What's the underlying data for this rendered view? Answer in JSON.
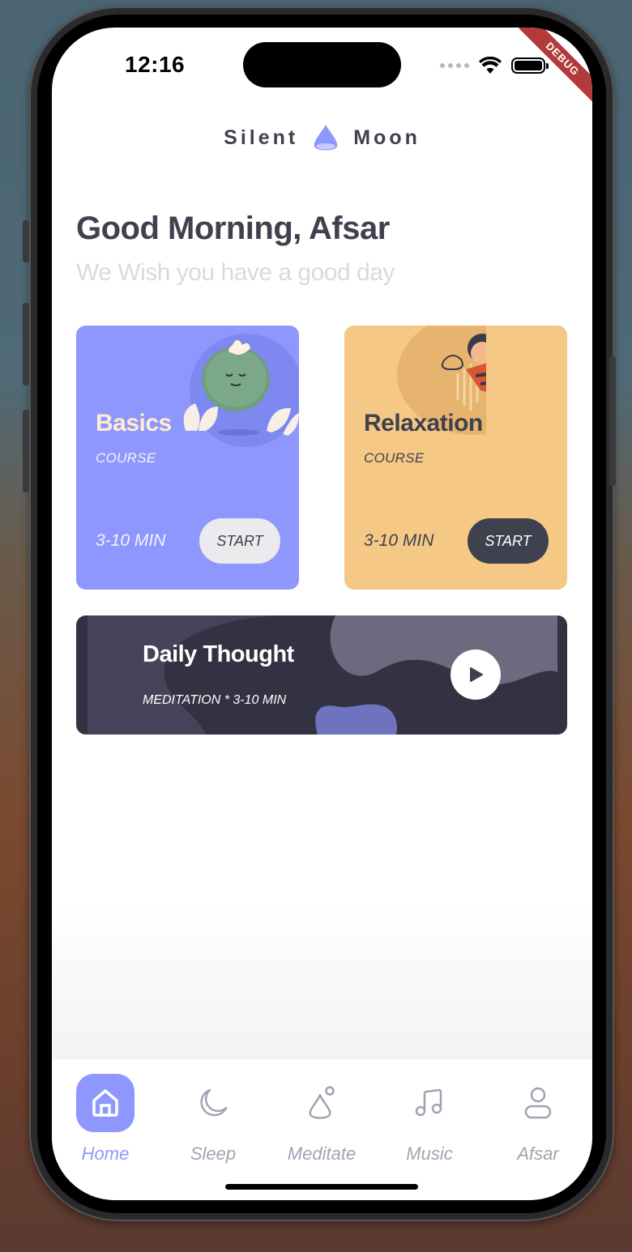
{
  "status": {
    "time": "12:16",
    "debug_label": "DEBUG"
  },
  "brand": {
    "left": "Silent",
    "right": "Moon",
    "logo_icon": "moon-drop-logo-icon"
  },
  "greeting": {
    "title": "Good Morning, Afsar",
    "subtitle": "We Wish you have a good day"
  },
  "cards": [
    {
      "title": "Basics",
      "type": "COURSE",
      "duration": "3-10 MIN",
      "button": "START",
      "bg": "#8e97fd"
    },
    {
      "title": "Relaxation",
      "type": "COURSE",
      "duration": "3-10 MIN",
      "button": "START",
      "bg": "#f5c885"
    }
  ],
  "daily": {
    "title": "Daily Thought",
    "subtitle": "MEDITATION * 3-10 MIN",
    "play_icon": "play-icon"
  },
  "tabs": [
    {
      "label": "Home",
      "icon": "home-icon",
      "active": true
    },
    {
      "label": "Sleep",
      "icon": "moon-icon",
      "active": false
    },
    {
      "label": "Meditate",
      "icon": "meditate-icon",
      "active": false
    },
    {
      "label": "Music",
      "icon": "music-note-icon",
      "active": false
    },
    {
      "label": "Afsar",
      "icon": "user-icon",
      "active": false
    }
  ],
  "colors": {
    "accent": "#8e97fd",
    "dark": "#3f414e",
    "yellow": "#f5c885"
  }
}
